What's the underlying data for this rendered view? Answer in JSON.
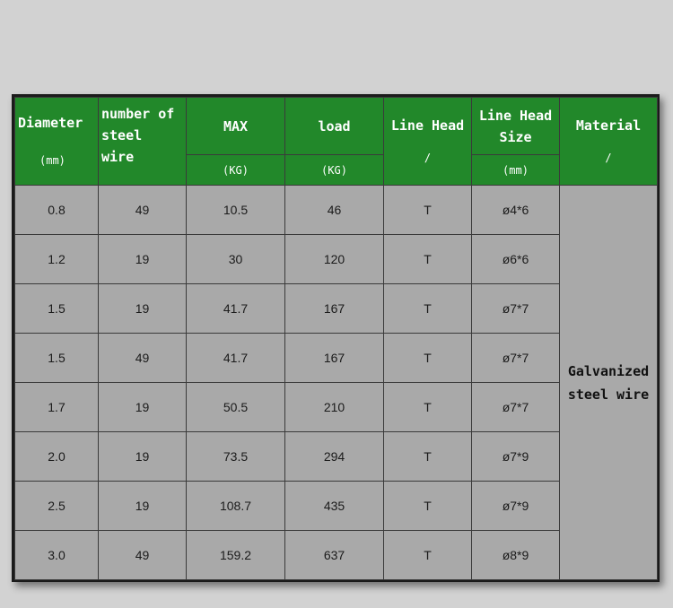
{
  "headers": {
    "diameter": "Diameter",
    "strands_line1": "number of",
    "strands_line2": "steel",
    "strands_line3": "wire",
    "max": "MAX",
    "load": "load",
    "line_head": "Line Head",
    "line_head_size_line1": "Line Head",
    "line_head_size_line2": "Size",
    "material": "Material"
  },
  "units": {
    "diameter": "(mm)",
    "max": "(KG)",
    "load": "(KG)",
    "line_head": "/",
    "line_head_size": "(mm)",
    "material": "/"
  },
  "rows": [
    {
      "diameter": "0.8",
      "strands": "49",
      "max": "10.5",
      "load": "46",
      "line_head": "T",
      "size": "ø4*6"
    },
    {
      "diameter": "1.2",
      "strands": "19",
      "max": "30",
      "load": "120",
      "line_head": "T",
      "size": "ø6*6"
    },
    {
      "diameter": "1.5",
      "strands": "19",
      "max": "41.7",
      "load": "167",
      "line_head": "T",
      "size": "ø7*7"
    },
    {
      "diameter": "1.5",
      "strands": "49",
      "max": "41.7",
      "load": "167",
      "line_head": "T",
      "size": "ø7*7"
    },
    {
      "diameter": "1.7",
      "strands": "19",
      "max": "50.5",
      "load": "210",
      "line_head": "T",
      "size": "ø7*7"
    },
    {
      "diameter": "2.0",
      "strands": "19",
      "max": "73.5",
      "load": "294",
      "line_head": "T",
      "size": "ø7*9"
    },
    {
      "diameter": "2.5",
      "strands": "19",
      "max": "108.7",
      "load": "435",
      "line_head": "T",
      "size": "ø7*9"
    },
    {
      "diameter": "3.0",
      "strands": "49",
      "max": "159.2",
      "load": "637",
      "line_head": "T",
      "size": "ø8*9"
    }
  ],
  "material": {
    "line1": "Galvanized",
    "line2": "steel wire"
  }
}
